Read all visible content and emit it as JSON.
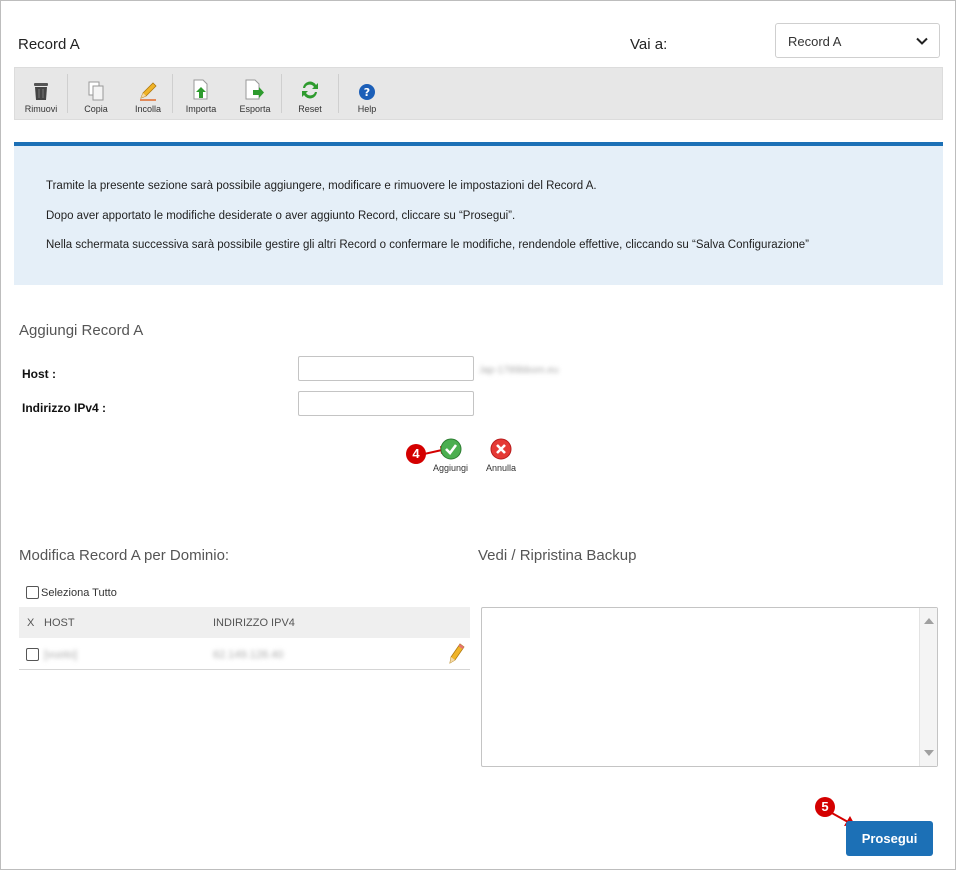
{
  "header": {
    "title": "Record A",
    "goto_label": "Vai a:",
    "goto_selected": "Record A"
  },
  "toolbar": {
    "items": [
      {
        "label": "Rimuovi",
        "icon": "trash-icon"
      },
      {
        "label": "Copia",
        "icon": "copy-icon"
      },
      {
        "label": "Incolla",
        "icon": "pencil-icon"
      },
      {
        "label": "Importa",
        "icon": "import-icon"
      },
      {
        "label": "Esporta",
        "icon": "export-icon"
      },
      {
        "label": "Reset",
        "icon": "reset-icon"
      },
      {
        "label": "Help",
        "icon": "help-icon"
      }
    ]
  },
  "info": {
    "line1": "Tramite la presente sezione sarà possibile aggiungere, modificare e rimuovere le impostazioni del Record A.",
    "line2": "Dopo aver apportato le modifiche desiderate o aver aggiunto Record, cliccare su “Prosegui”.",
    "line3": "Nella schermata successiva sarà possibile gestire gli altri Record o confermare le modifiche, rendendole effettive, cliccando su “Salva Configurazione”"
  },
  "add_form": {
    "title": "Aggiungi Record A",
    "host_label": "Host :",
    "host_value": "",
    "host_suffix": ".lap-1789bbom.eu",
    "ipv4_label": "Indirizzo IPv4 :",
    "ipv4_value": "",
    "add_label": "Aggiungi",
    "cancel_label": "Annulla",
    "marker_add": "4"
  },
  "records": {
    "title": "Modifica Record A per Dominio:",
    "select_all_label": "Seleziona Tutto",
    "columns": {
      "x": "X",
      "host": "HOST",
      "ipv4": "INDIRIZZO IPV4"
    },
    "rows": [
      {
        "host": "[vuoto]",
        "ipv4": "62.149.128.40"
      }
    ]
  },
  "backup": {
    "title": "Vedi / Ripristina Backup"
  },
  "footer": {
    "proceed_label": "Prosegui",
    "marker_proceed": "5"
  },
  "colors": {
    "accent": "#1c70b6",
    "info_bg": "#e5eff8",
    "marker": "#d40000"
  }
}
